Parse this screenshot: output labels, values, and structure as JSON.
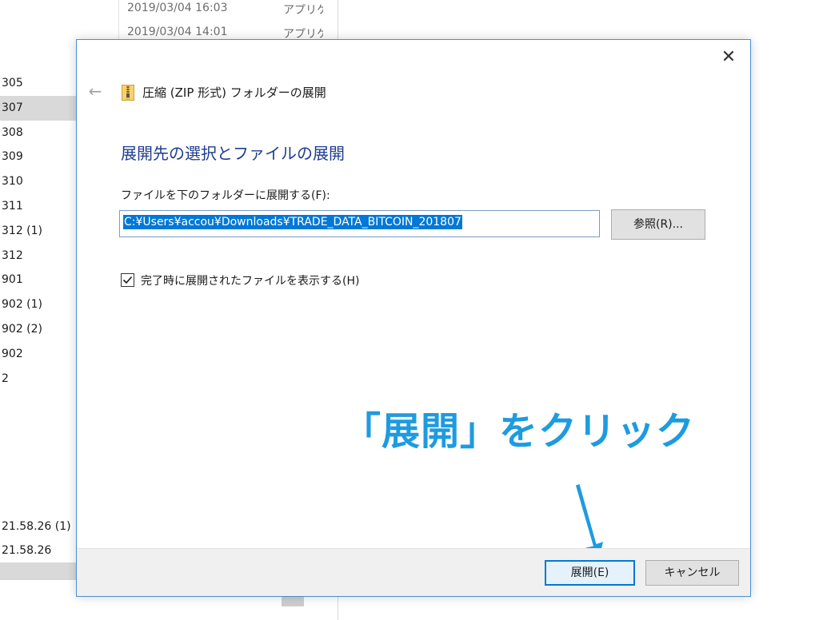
{
  "explorer": {
    "top_rows": [
      {
        "date": "2019/03/04 16:03",
        "type": "アプリケ"
      },
      {
        "date": "2019/03/04 14:01",
        "type": "アプリケ"
      }
    ],
    "items": [
      {
        "label": "305"
      },
      {
        "label": "307",
        "selected": true
      },
      {
        "label": "308"
      },
      {
        "label": "309"
      },
      {
        "label": "310"
      },
      {
        "label": "311"
      },
      {
        "label": "312 (1)"
      },
      {
        "label": "312"
      },
      {
        "label": "901"
      },
      {
        "label": "902 (1)"
      },
      {
        "label": "902 (2)"
      },
      {
        "label": "902"
      },
      {
        "label": "2"
      }
    ],
    "bottom_items": [
      {
        "label": "21.58.26 (1)"
      },
      {
        "label": "21.58.26"
      },
      {
        "label": "",
        "selected": true
      }
    ]
  },
  "dialog": {
    "window_title": "圧縮 (ZIP 形式) フォルダーの展開",
    "heading": "展開先の選択とファイルの展開",
    "path_label": "ファイルを下のフォルダーに展開する(F):",
    "path_value": "C:¥Users¥accou¥Downloads¥TRADE_DATA_BITCOIN_201807",
    "browse_label": "参照(R)...",
    "checkbox": {
      "label": "完了時に展開されたファイルを表示する(H)",
      "checked": true
    },
    "extract_label": "展開(E)",
    "cancel_label": "キャンセル",
    "close_glyph": "✕",
    "back_glyph": "←"
  },
  "annotation": {
    "text": "「展開」をクリック",
    "color": "#1e9be0"
  },
  "colors": {
    "accent": "#0078d7",
    "heading": "#1e3d8f",
    "dialog_border": "#4a90d0"
  }
}
